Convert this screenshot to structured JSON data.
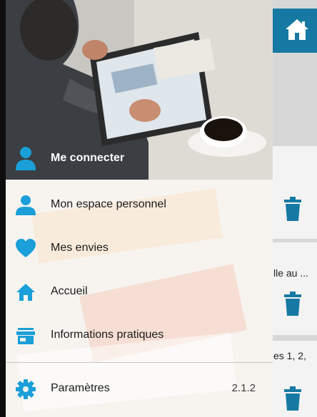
{
  "background_app": {
    "card_texts": [
      "lle au ...",
      "es 1, 2,"
    ]
  },
  "drawer": {
    "login_label": "Me connecter",
    "menu": [
      {
        "label": "Mon espace personnel",
        "icon": "user-icon"
      },
      {
        "label": "Mes envies",
        "icon": "heart-icon"
      },
      {
        "label": "Accueil",
        "icon": "home-icon"
      },
      {
        "label": "Informations pratiques",
        "icon": "store-icon"
      },
      {
        "label": "Paramètres",
        "icon": "gear-icon"
      }
    ],
    "version": "2.1.2"
  },
  "colors": {
    "accent_blue": "#1a9fd9",
    "topbar_blue": "#1679a3"
  }
}
